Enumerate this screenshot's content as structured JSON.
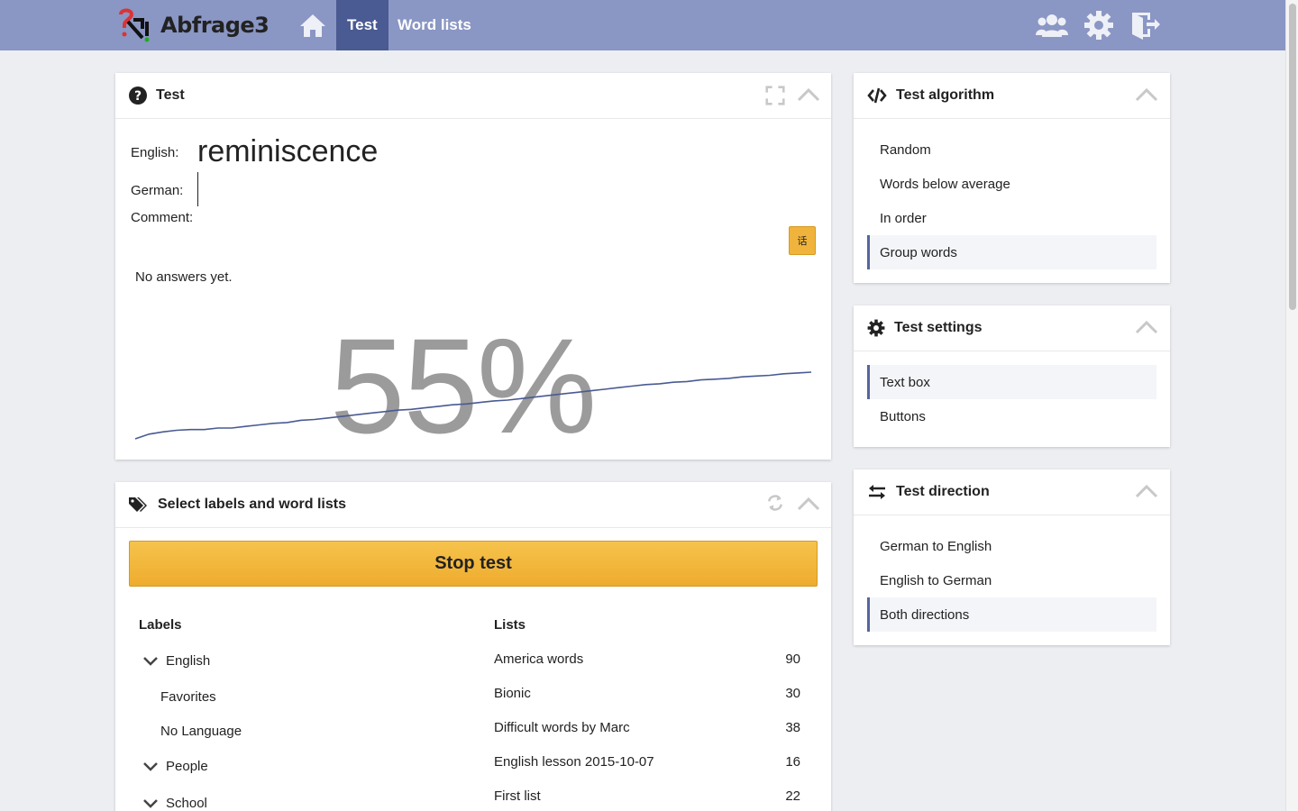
{
  "app": {
    "name": "Abfrage3"
  },
  "nav": {
    "tabs": [
      {
        "label": "Test"
      },
      {
        "label": "Word lists"
      }
    ]
  },
  "test_panel": {
    "title": "Test",
    "english_label": "English:",
    "german_label": "German:",
    "comment_label": "Comment:",
    "word": "reminiscence",
    "char_button": "话",
    "no_answers": "No answers yet.",
    "percent": "55%",
    "progress_trend": [
      0.0,
      0.06,
      0.09,
      0.11,
      0.12,
      0.12,
      0.14,
      0.14,
      0.16,
      0.18,
      0.2,
      0.21,
      0.24,
      0.25,
      0.27,
      0.29,
      0.31,
      0.33,
      0.35,
      0.37,
      0.38,
      0.4,
      0.42,
      0.44,
      0.45,
      0.47,
      0.49,
      0.5,
      0.52,
      0.54,
      0.56,
      0.58,
      0.6,
      0.62,
      0.64,
      0.66,
      0.68,
      0.7,
      0.71,
      0.73,
      0.74,
      0.76,
      0.77,
      0.78,
      0.8,
      0.81,
      0.82,
      0.84,
      0.85,
      0.86
    ]
  },
  "select_panel": {
    "title": "Select labels and word lists",
    "stop_button": "Stop test",
    "labels_heading": "Labels",
    "lists_heading": "Lists",
    "labels": [
      {
        "label": "English",
        "expandable": true
      },
      {
        "label": "Favorites",
        "expandable": false
      },
      {
        "label": "No Language",
        "expandable": false
      },
      {
        "label": "People",
        "expandable": true
      },
      {
        "label": "School",
        "expandable": true
      }
    ],
    "lists": [
      {
        "name": "America words",
        "count": "90"
      },
      {
        "name": "Bionic",
        "count": "30"
      },
      {
        "name": "Difficult words by Marc",
        "count": "38"
      },
      {
        "name": "English lesson 2015-10-07",
        "count": "16"
      },
      {
        "name": "First list",
        "count": "22"
      }
    ]
  },
  "algorithm_panel": {
    "title": "Test algorithm",
    "options": [
      "Random",
      "Words below average",
      "In order",
      "Group words"
    ],
    "selected": "Group words"
  },
  "settings_panel": {
    "title": "Test settings",
    "options": [
      "Text box",
      "Buttons"
    ],
    "selected": "Text box"
  },
  "direction_panel": {
    "title": "Test direction",
    "options": [
      "German to English",
      "English to German",
      "Both directions"
    ],
    "selected": "Both directions"
  },
  "colors": {
    "topbar": "#8a96c4",
    "active_tab": "#4a5a92",
    "accent": "#f0b43c",
    "trend_line": "#4a5a92"
  },
  "icons": {
    "home": "home-icon",
    "users": "users-icon",
    "settings": "gear-icon",
    "logout": "logout-icon"
  }
}
